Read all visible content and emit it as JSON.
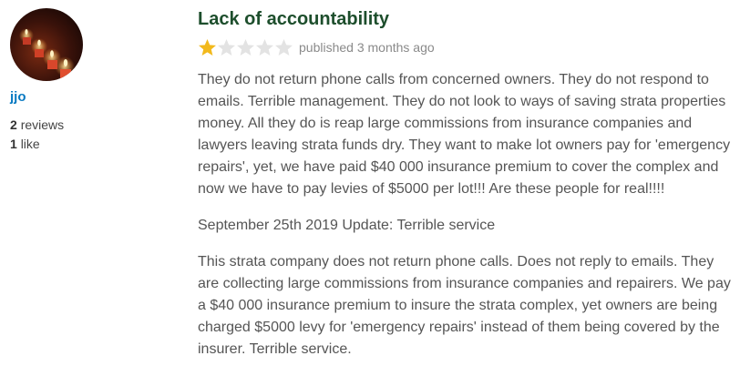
{
  "reviewer": {
    "avatar_icon": "candles-photo-avatar",
    "name": "jjo",
    "reviews_count": "2",
    "reviews_label": "reviews",
    "likes_count": "1",
    "likes_label": "like"
  },
  "review": {
    "title": "Lack of accountability",
    "rating": 1,
    "rating_max": 5,
    "published": "published 3 months ago",
    "paragraphs": [
      "They do not return phone calls from concerned owners. They do not respond to emails. Terrible management. They do not look to ways of saving strata properties money. All they do is reap large commissions from insurance companies and lawyers leaving strata funds dry. They want to make lot owners pay for 'emergency repairs', yet, we have paid $40 000 insurance premium to cover the complex and now we have to pay levies of $5000 per lot!!! Are these people for real!!!!",
      "September 25th 2019 Update: Terrible service",
      "This strata company does not return phone calls. Does not reply to emails. They are collecting large commissions from insurance companies and repairers. We pay a $40 000 insurance premium to insure the strata complex, yet owners are being charged $5000 levy for 'emergency repairs' instead of them being covered by the insurer. Terrible service."
    ]
  },
  "colors": {
    "star_filled": "#f2b91c",
    "star_empty": "#e3e3e3",
    "title": "#1d4e2c",
    "username": "#0a7ac2"
  }
}
